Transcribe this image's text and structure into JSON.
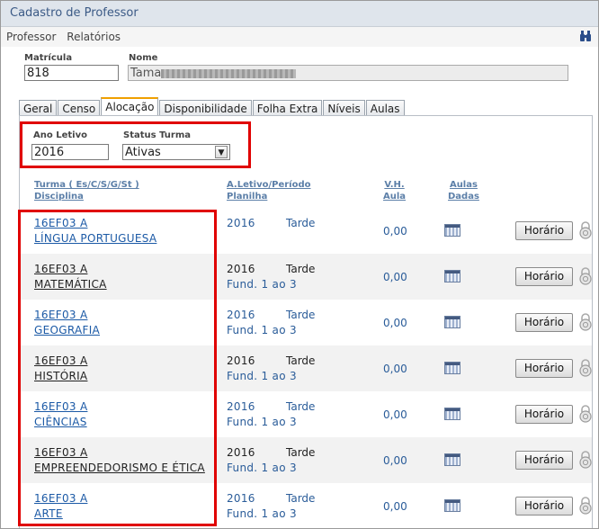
{
  "window": {
    "title": "Cadastro de Professor"
  },
  "menu": {
    "items": [
      {
        "label": "Professor"
      },
      {
        "label": "Relatórios"
      }
    ],
    "search_icon": "binoculars-icon"
  },
  "form": {
    "matricula_label": "Matrícula",
    "matricula_value": "818",
    "nome_label": "Nome",
    "nome_value": "Tama"
  },
  "tabs": [
    {
      "label": "Geral"
    },
    {
      "label": "Censo"
    },
    {
      "label": "Alocação",
      "active": true
    },
    {
      "label": "Disponibilidade"
    },
    {
      "label": "Folha Extra"
    },
    {
      "label": "Níveis"
    },
    {
      "label": "Aulas"
    }
  ],
  "filters": {
    "ano_label": "Ano Letivo",
    "ano_value": "2016",
    "status_label": "Status Turma",
    "status_value": "Ativas"
  },
  "table": {
    "headers": {
      "turma_l1": "Turma ( Es/C/S/G/St )",
      "turma_l2": "Disciplina",
      "ano_l1": "A.Letivo/Período",
      "ano_l2": "Planilha",
      "vh_l1": "V.H.",
      "vh_l2": "Aula",
      "aulas_l1": "Aulas",
      "aulas_l2": "Dadas"
    },
    "button_label": "Horário",
    "rows": [
      {
        "turma": "16EF03 A",
        "disciplina": "LÍNGUA PORTUGUESA",
        "ano": "2016",
        "periodo": "Tarde",
        "planilha": "",
        "vh": "0,00",
        "link": true
      },
      {
        "turma": "16EF03 A",
        "disciplina": "MATEMÁTICA",
        "ano": "2016",
        "periodo": "Tarde",
        "planilha": "Fund. 1 ao 3",
        "vh": "0,00",
        "link": false
      },
      {
        "turma": "16EF03 A",
        "disciplina": "GEOGRAFIA",
        "ano": "2016",
        "periodo": "Tarde",
        "planilha": "Fund. 1 ao 3",
        "vh": "0,00",
        "link": true
      },
      {
        "turma": "16EF03 A",
        "disciplina": "HISTÓRIA",
        "ano": "2016",
        "periodo": "Tarde",
        "planilha": "Fund. 1 ao 3",
        "vh": "0,00",
        "link": false
      },
      {
        "turma": "16EF03 A",
        "disciplina": "CIÊNCIAS",
        "ano": "2016",
        "periodo": "Tarde",
        "planilha": "Fund. 1 ao 3",
        "vh": "0,00",
        "link": true
      },
      {
        "turma": "16EF03 A",
        "disciplina": "EMPREENDEDORISMO E ÉTICA",
        "ano": "2016",
        "periodo": "Tarde",
        "planilha": "Fund. 1 ao 3",
        "vh": "0,00",
        "link": false
      },
      {
        "turma": "16EF03 A",
        "disciplina": "ARTE",
        "ano": "2016",
        "periodo": "Tarde",
        "planilha": "Fund. 1 ao 3",
        "vh": "0,00",
        "link": true
      }
    ]
  },
  "colors": {
    "highlight": "#e00000",
    "link": "#1c5aa6",
    "active_tab_accent": "#f0a000"
  }
}
